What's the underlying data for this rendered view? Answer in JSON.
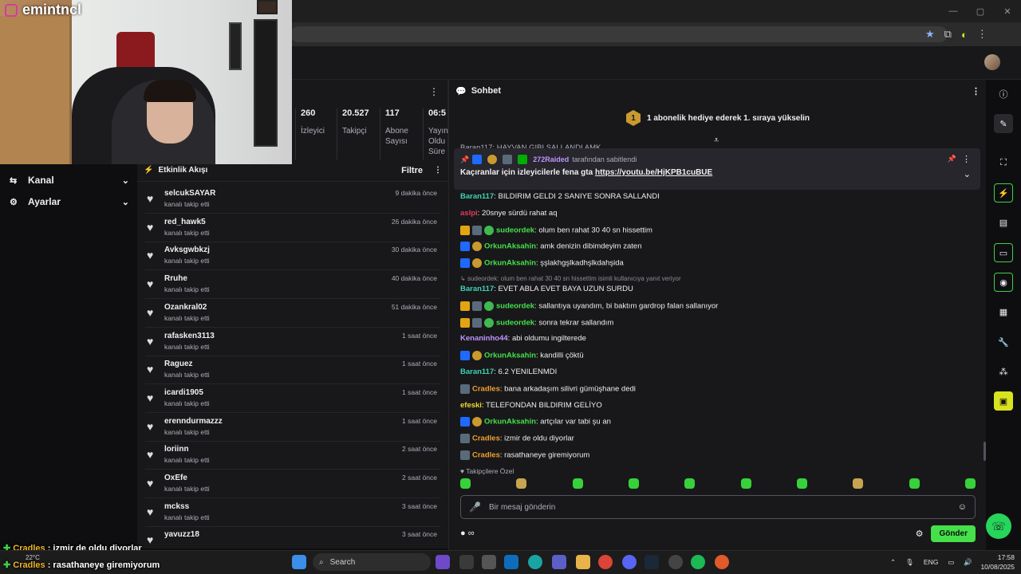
{
  "webcam": {
    "username": "emintncl"
  },
  "left_nav": [
    {
      "label": "Kanal",
      "icon": "channel-icon"
    },
    {
      "label": "Ayarlar",
      "icon": "gear-icon"
    }
  ],
  "stats": [
    {
      "value": "260",
      "label": "İzleyici"
    },
    {
      "value": "20.527",
      "label": "Takipçi"
    },
    {
      "value": "117",
      "label": "Abone Sayısı"
    },
    {
      "value": "06:5",
      "label": "Yayın Oldu Süre"
    }
  ],
  "activity": {
    "title": "Etkinlik Akışı",
    "filter": "Filtre",
    "items": [
      {
        "name": "selcukSAYAR",
        "sub": "kanalı takip etti",
        "time": "9 dakika önce"
      },
      {
        "name": "red_hawk5",
        "sub": "kanalı takip etti",
        "time": "26 dakika önce"
      },
      {
        "name": "Avksgwbkzj",
        "sub": "kanalı takip etti",
        "time": "30 dakika önce"
      },
      {
        "name": "Rruhe",
        "sub": "kanalı takip etti",
        "time": "40 dakika önce"
      },
      {
        "name": "Ozankral02",
        "sub": "kanalı takip etti",
        "time": "51 dakika önce"
      },
      {
        "name": "rafasken3113",
        "sub": "kanalı takip etti",
        "time": "1 saat önce"
      },
      {
        "name": "Raguez",
        "sub": "kanalı takip etti",
        "time": "1 saat önce"
      },
      {
        "name": "icardi1905",
        "sub": "kanalı takip etti",
        "time": "1 saat önce"
      },
      {
        "name": "erenndurmazzz",
        "sub": "kanalı takip etti",
        "time": "1 saat önce"
      },
      {
        "name": "loriinn",
        "sub": "kanalı takip etti",
        "time": "2 saat önce"
      },
      {
        "name": "OxEfe",
        "sub": "kanalı takip etti",
        "time": "2 saat önce"
      },
      {
        "name": "mckss",
        "sub": "kanalı takip etti",
        "time": "3 saat önce"
      },
      {
        "name": "yavuzz18",
        "sub": "",
        "time": "3 saat önce"
      }
    ]
  },
  "chat": {
    "title": "Sohbet",
    "sub_banner": {
      "coin": "1",
      "text": "1 abonelik hediye ederek 1. sıraya yükselin"
    },
    "pinned": {
      "by_user": "272Raided",
      "by_suffix": "tarafından sabitlendi",
      "text": "Kaçıranlar için izleyicilerle fena gta ",
      "link": "https://youtu.be/HjKPB1cuBUE"
    },
    "partial_top": "Baran117: HAYVAN GIBI SALLANDI AMK",
    "messages": [
      {
        "user": "Baran117",
        "color": "#3fd1b4",
        "badges": [],
        "text": "BILDIRIM GELDI 2 SANIYE SONRA SALLANDI"
      },
      {
        "user": "aslpi",
        "color": "#e03b5e",
        "badges": [],
        "text": "20snye sürdü rahat aq"
      },
      {
        "user": "sudeordek",
        "color": "#45e04a",
        "badges": [
          "crown",
          "tier",
          "verified"
        ],
        "text": "olum ben rahat 30 40 sn hissettim"
      },
      {
        "user": "OrkunAksahin",
        "color": "#45e04a",
        "badges": [
          "prime",
          "sub"
        ],
        "text": "amk denizin dibimdeyim zaten"
      },
      {
        "user": "OrkunAksahin",
        "color": "#45e04a",
        "badges": [
          "prime",
          "sub"
        ],
        "text": "şşlakhgşlkadhşlkdahşida"
      },
      {
        "user": "Baran117",
        "color": "#3fd1b4",
        "badges": [],
        "text": "EVET ABLA EVET BAYA UZUN SURDU",
        "reply": "sudeordek: olum ben rahat 30 40 sn hissettim isimli kullanıcıya yanıt veriyor"
      },
      {
        "user": "sudeordek",
        "color": "#45e04a",
        "badges": [
          "crown",
          "tier",
          "verified"
        ],
        "text": "sallantıya uyandım, bi baktım gardrop falan sallanıyor"
      },
      {
        "user": "sudeordek",
        "color": "#45e04a",
        "badges": [
          "crown",
          "tier",
          "verified"
        ],
        "text": "sonra tekrar sallandım"
      },
      {
        "user": "Kenaninho44",
        "color": "#bf94ff",
        "badges": [],
        "text": "abi oldumu ingilterede"
      },
      {
        "user": "OrkunAksahin",
        "color": "#45e04a",
        "badges": [
          "prime",
          "sub"
        ],
        "text": "kandilli çöktü"
      },
      {
        "user": "Baran117",
        "color": "#3fd1b4",
        "badges": [],
        "text": "6.2 YENILENMDI"
      },
      {
        "user": "Cradles",
        "color": "#f0a22b",
        "badges": [
          "tier"
        ],
        "text": "bana arkadaşım silivri gümüşhane dedi"
      },
      {
        "user": "efeski",
        "color": "#f0d52b",
        "badges": [],
        "text": "TELEFONDAN BILDIRIM GELİYO"
      },
      {
        "user": "OrkunAksahin",
        "color": "#45e04a",
        "badges": [
          "prime",
          "sub"
        ],
        "text": "artçılar var tabi şu an"
      },
      {
        "user": "Cradles",
        "color": "#f0a22b",
        "badges": [
          "tier"
        ],
        "text": "izmir de oldu diyorlar"
      },
      {
        "user": "Cradles",
        "color": "#f0a22b",
        "badges": [
          "tier"
        ],
        "text": "rasathaneye giremiyorum"
      }
    ],
    "followers_only": "Takipçilere Özel",
    "input_placeholder": "Bir mesaj gönderin",
    "points": "∞",
    "send_label": "Gönder"
  },
  "overlay_chat": [
    {
      "user": "Cradles",
      "text": "izmir de oldu diyorlar"
    },
    {
      "user": "Cradles",
      "text": "rasathaneye giremiyorum"
    }
  ],
  "taskbar": {
    "weather": "22°C",
    "search_label": "Search",
    "lang": "ENG",
    "time": "17:58",
    "date": "10/08/2025"
  }
}
